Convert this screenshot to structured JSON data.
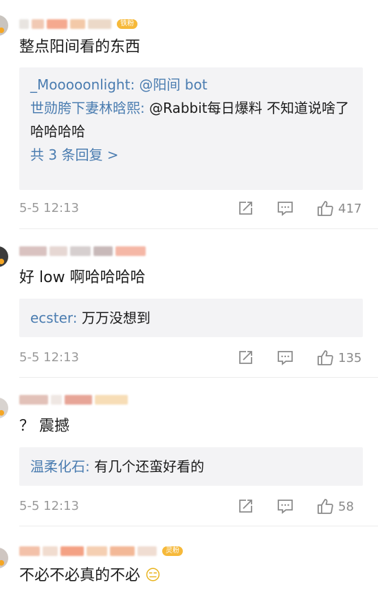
{
  "comments": [
    {
      "fan_badge": "铁粉",
      "body": "整点阳间看的东西",
      "replies": [
        {
          "user": "_Mooooonlight:",
          "text": " @阳间 bot"
        },
        {
          "user": "世勋胯下妻林晗熙:",
          "text": " @Rabbit每日爆料 不知道说啥了哈哈哈哈"
        }
      ],
      "more_replies": "共 3 条回复 >",
      "time": "5-5 12:13",
      "likes": "417"
    },
    {
      "fan_badge": "",
      "body": "好 low 啊哈哈哈哈",
      "replies": [
        {
          "user": "ecster:",
          "text": " 万万没想到"
        }
      ],
      "more_replies": "",
      "time": "5-5 12:13",
      "likes": "135"
    },
    {
      "fan_badge": "",
      "body": "？ 震撼",
      "replies": [
        {
          "user": "温柔化石:",
          "text": " 有几个还蛮好看的"
        }
      ],
      "more_replies": "",
      "time": "5-5 12:13",
      "likes": "58"
    },
    {
      "fan_badge": "灵粉",
      "body": "不必不必真的不必",
      "emoji": "😑",
      "replies": [],
      "more_replies": "",
      "time": "",
      "likes": ""
    }
  ],
  "icons": {
    "share": "share-icon",
    "comment": "comment-icon",
    "like": "thumbs-up-icon"
  },
  "colors": {
    "link": "#4a7cb0",
    "reply_bg": "#f3f3f5",
    "meta_gray": "#9a9a9a",
    "badge": "#f6b93a"
  }
}
